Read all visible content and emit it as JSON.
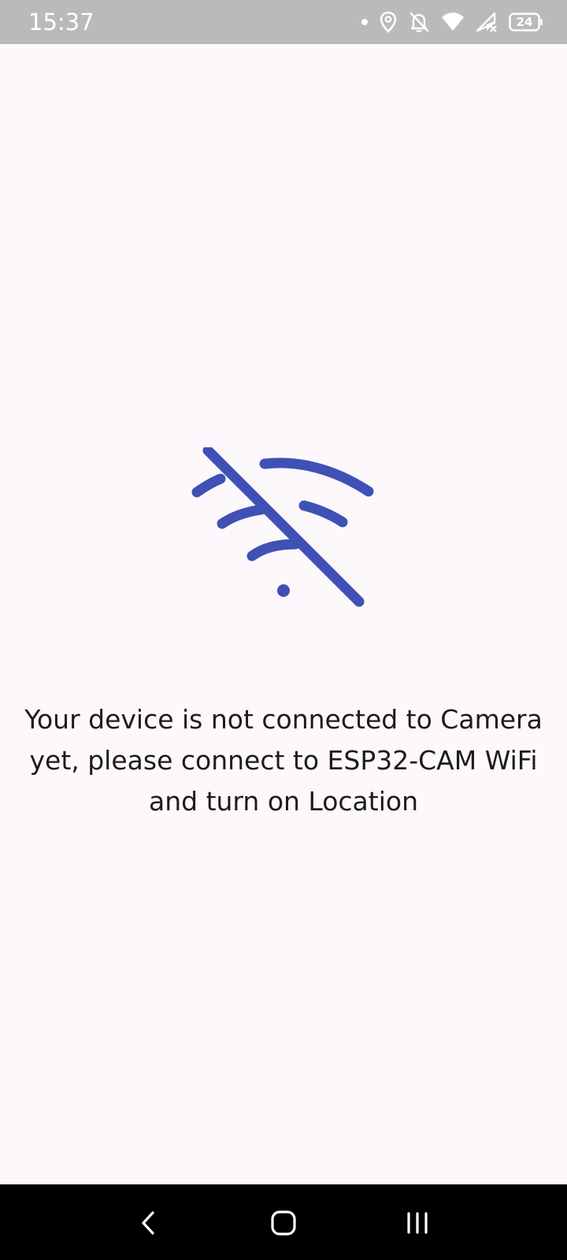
{
  "status_bar": {
    "time": "15:37",
    "battery_level": "24",
    "icons": [
      "notification-dot-icon",
      "location-icon",
      "notifications-off-icon",
      "wifi-icon",
      "cellular-no-signal-icon",
      "battery-icon"
    ]
  },
  "main": {
    "icon": "wifi-off-icon",
    "icon_color": "#3f51b5",
    "message": "Your device is not connected to Camera yet, please connect to ESP32-CAM WiFi and turn on Location"
  },
  "nav_bar": {
    "buttons": [
      "back-icon",
      "home-icon",
      "recents-icon"
    ]
  }
}
